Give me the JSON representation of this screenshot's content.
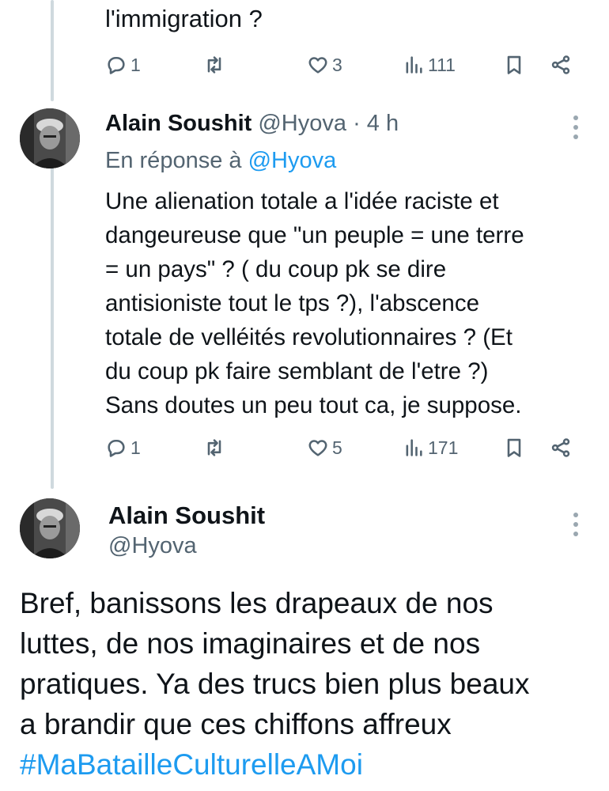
{
  "previous_tweet": {
    "text_tail": "l'immigration ?",
    "actions": {
      "replies": "1",
      "retweets": "",
      "likes": "3",
      "views": "111"
    }
  },
  "reply_tweet": {
    "name": "Alain Soushit",
    "handle": "@Hyova",
    "time": "· 4 h",
    "replying_prefix": "En réponse à",
    "replying_to": "@Hyova",
    "lines": [
      "Une alienation totale a l'idée raciste et",
      "dangeureuse que \"un peuple = une terre",
      "= un pays\" ? ( du coup pk se dire",
      "antisioniste tout le tps ?), l'abscence",
      "totale de velléités revolutionnaires ? (Et",
      "du coup pk faire semblant de l'etre ?)",
      "Sans doutes un peu tout ca, je suppose."
    ],
    "actions": {
      "replies": "1",
      "retweets": "",
      "likes": "5",
      "views": "171"
    }
  },
  "main_tweet": {
    "name": "Alain Soushit",
    "handle": "@Hyova",
    "lines": [
      "Bref, banissons les drapeaux de nos",
      "luttes, de nos imaginaires et de nos",
      "pratiques. Ya des trucs bien plus beaux",
      "a brandir que ces chiffons affreux"
    ],
    "hashtag": "#MaBatailleCulturelleAMoi"
  },
  "icons": {
    "reply": "reply-icon",
    "retweet": "retweet-icon",
    "like": "heart-icon",
    "views": "views-icon",
    "bookmark": "bookmark-icon",
    "share": "share-icon",
    "more": "more-vertical-icon"
  },
  "colors": {
    "accent": "#1d9bf0",
    "secondary_text": "#536471",
    "thread_line": "#cfd9de"
  }
}
